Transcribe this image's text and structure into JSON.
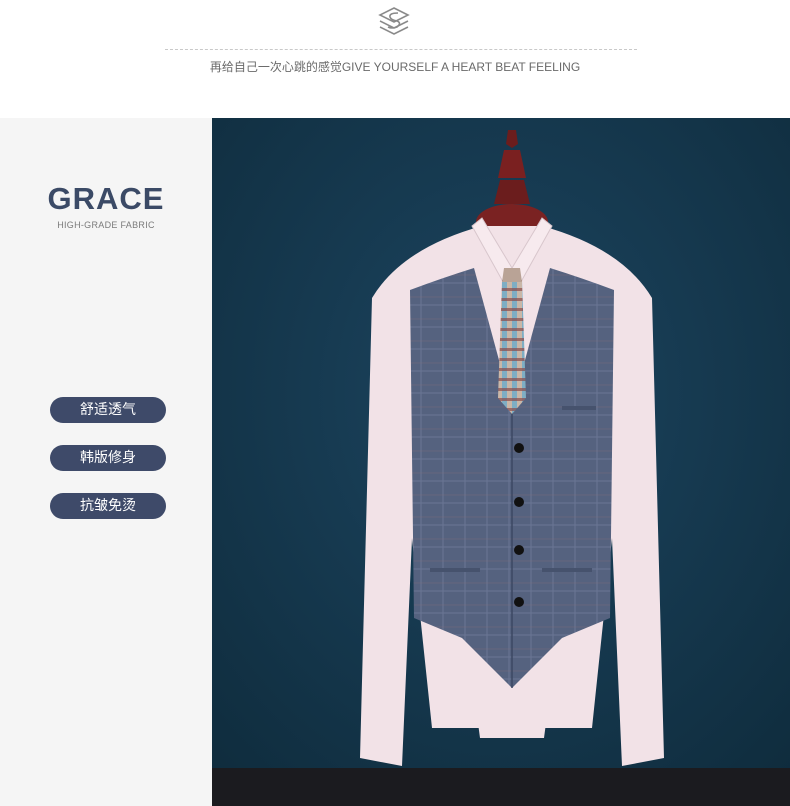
{
  "header": {
    "logo_icon": "stacked-s-icon",
    "slogan": "再给自己一次心跳的感觉GIVE YOURSELF A HEART BEAT FEELING"
  },
  "left_panel": {
    "brand": "GRACE",
    "brand_sub": "HIGH-GRADE FABRIC",
    "tags": [
      "舒适透气",
      "韩版修身",
      "抗皱免烫"
    ]
  },
  "photo": {
    "subject": "product-photo-vest-on-mannequin",
    "background_color": "#16394e",
    "vest_color": "#4f5d7a",
    "shirt_color": "#f1dfe4"
  }
}
